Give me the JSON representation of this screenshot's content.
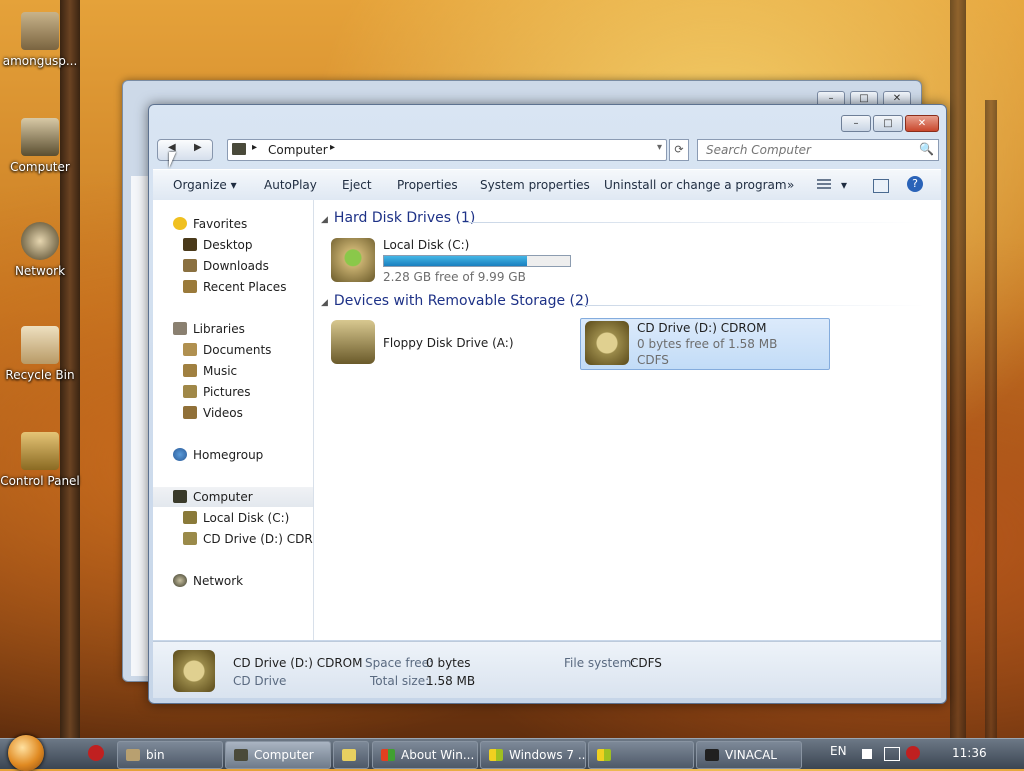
{
  "desktop": {
    "icons": [
      {
        "label": "amongusp..."
      },
      {
        "label": "Computer"
      },
      {
        "label": "Network"
      },
      {
        "label": "Recycle Bin"
      },
      {
        "label": "Control Panel"
      }
    ]
  },
  "window": {
    "buttons": {
      "minimize": "–",
      "maximize": "□",
      "close": "✕"
    },
    "nav": {
      "back": "◀",
      "forward": "▶"
    },
    "address": {
      "location": "Computer",
      "sep": "▸",
      "dropdown": "▾"
    },
    "refresh": "⟳",
    "search": {
      "placeholder": "Search Computer"
    },
    "toolbar": {
      "organize": "Organize ▾",
      "autoplay": "AutoPlay",
      "eject": "Eject",
      "properties": "Properties",
      "system_properties": "System properties",
      "uninstall": "Uninstall or change a program",
      "more": "»",
      "views": "▾"
    },
    "nav_pane": {
      "favorites": "Favorites",
      "desktop": "Desktop",
      "downloads": "Downloads",
      "recent_places": "Recent Places",
      "libraries": "Libraries",
      "documents": "Documents",
      "music": "Music",
      "pictures": "Pictures",
      "videos": "Videos",
      "homegroup": "Homegroup",
      "computer": "Computer",
      "local_disk": "Local Disk (C:)",
      "cd_drive": "CD Drive (D:) CDROM",
      "network": "Network"
    },
    "content": {
      "hdd_group": "Hard Disk Drives (1)",
      "removable_group": "Devices with Removable Storage (2)",
      "local_disk": {
        "name": "Local Disk (C:)",
        "free": "2.28 GB free of 9.99 GB",
        "used_fraction": 0.77
      },
      "floppy": {
        "name": "Floppy Disk Drive (A:)"
      },
      "cd": {
        "name": "CD Drive (D:) CDROM",
        "free": "0 bytes free of 1.58 MB",
        "fs": "CDFS"
      }
    },
    "details": {
      "name": "CD Drive (D:) CDROM",
      "type": "CD Drive",
      "space_free_label": "Space free:",
      "space_free": "0 bytes",
      "total_size_label": "Total size:",
      "total_size": "1.58 MB",
      "fs_label": "File system:",
      "fs": "CDFS"
    }
  },
  "taskbar": {
    "items": [
      {
        "label": "bin"
      },
      {
        "label": "Computer"
      },
      {
        "label": ""
      },
      {
        "label": "About Win..."
      },
      {
        "label": "Windows 7 ..."
      },
      {
        "label": ""
      },
      {
        "label": "VINACAL"
      }
    ],
    "lang": "EN",
    "time": "11:36"
  },
  "colors": {
    "accent": "#1e3287",
    "progress": "#1a7fbf",
    "selection": "#c2dcf7"
  }
}
